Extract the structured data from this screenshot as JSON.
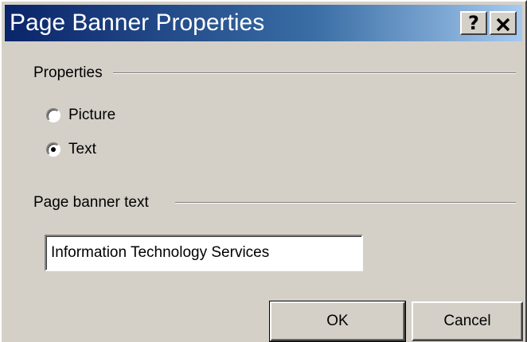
{
  "dialog": {
    "title": "Page Banner Properties",
    "help_label": "?",
    "properties_group": {
      "label": "Properties",
      "options": [
        {
          "label": "Picture",
          "checked": false
        },
        {
          "label": "Text",
          "checked": true
        }
      ]
    },
    "banner_text_group": {
      "label": "Page banner text",
      "value": "Information Technology Services"
    },
    "buttons": {
      "ok": "OK",
      "cancel": "Cancel"
    }
  }
}
